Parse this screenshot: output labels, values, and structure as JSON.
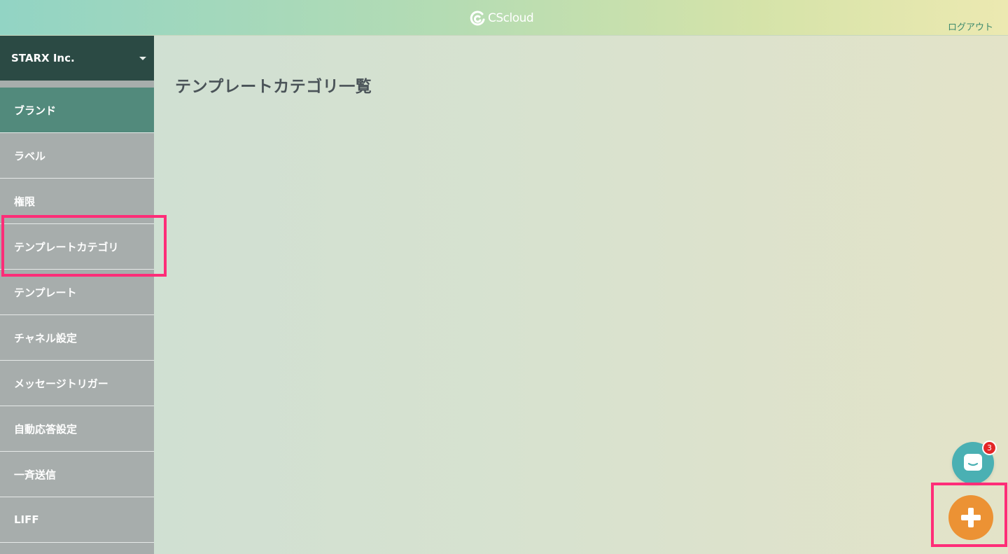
{
  "header": {
    "logo_text": "CScloud",
    "logout_label": "ログアウト"
  },
  "sidebar": {
    "org_name": "STARX Inc.",
    "items": [
      {
        "label": "ブランド",
        "active": true
      },
      {
        "label": "ラベル"
      },
      {
        "label": "権限"
      },
      {
        "label": "テンプレートカテゴリ",
        "highlighted": true
      },
      {
        "label": "テンプレート"
      },
      {
        "label": "チャネル設定"
      },
      {
        "label": "メッセージトリガー"
      },
      {
        "label": "自動応答設定"
      },
      {
        "label": "一斉送信"
      },
      {
        "label": "LIFF"
      }
    ]
  },
  "main": {
    "title": "テンプレートカテゴリ一覧"
  },
  "chat": {
    "badge_count": "3"
  },
  "colors": {
    "accent_active": "#528a7c",
    "org_bg": "#2b4a44",
    "highlight": "#ff2d78",
    "add_button": "#ec9234",
    "chat_button": "#4ab0b3",
    "badge": "#e32626"
  },
  "icons": {
    "logo": "cscloud-logo-icon",
    "chat": "chat-bubble-icon",
    "add": "plus-icon",
    "caret": "caret-down-icon"
  }
}
